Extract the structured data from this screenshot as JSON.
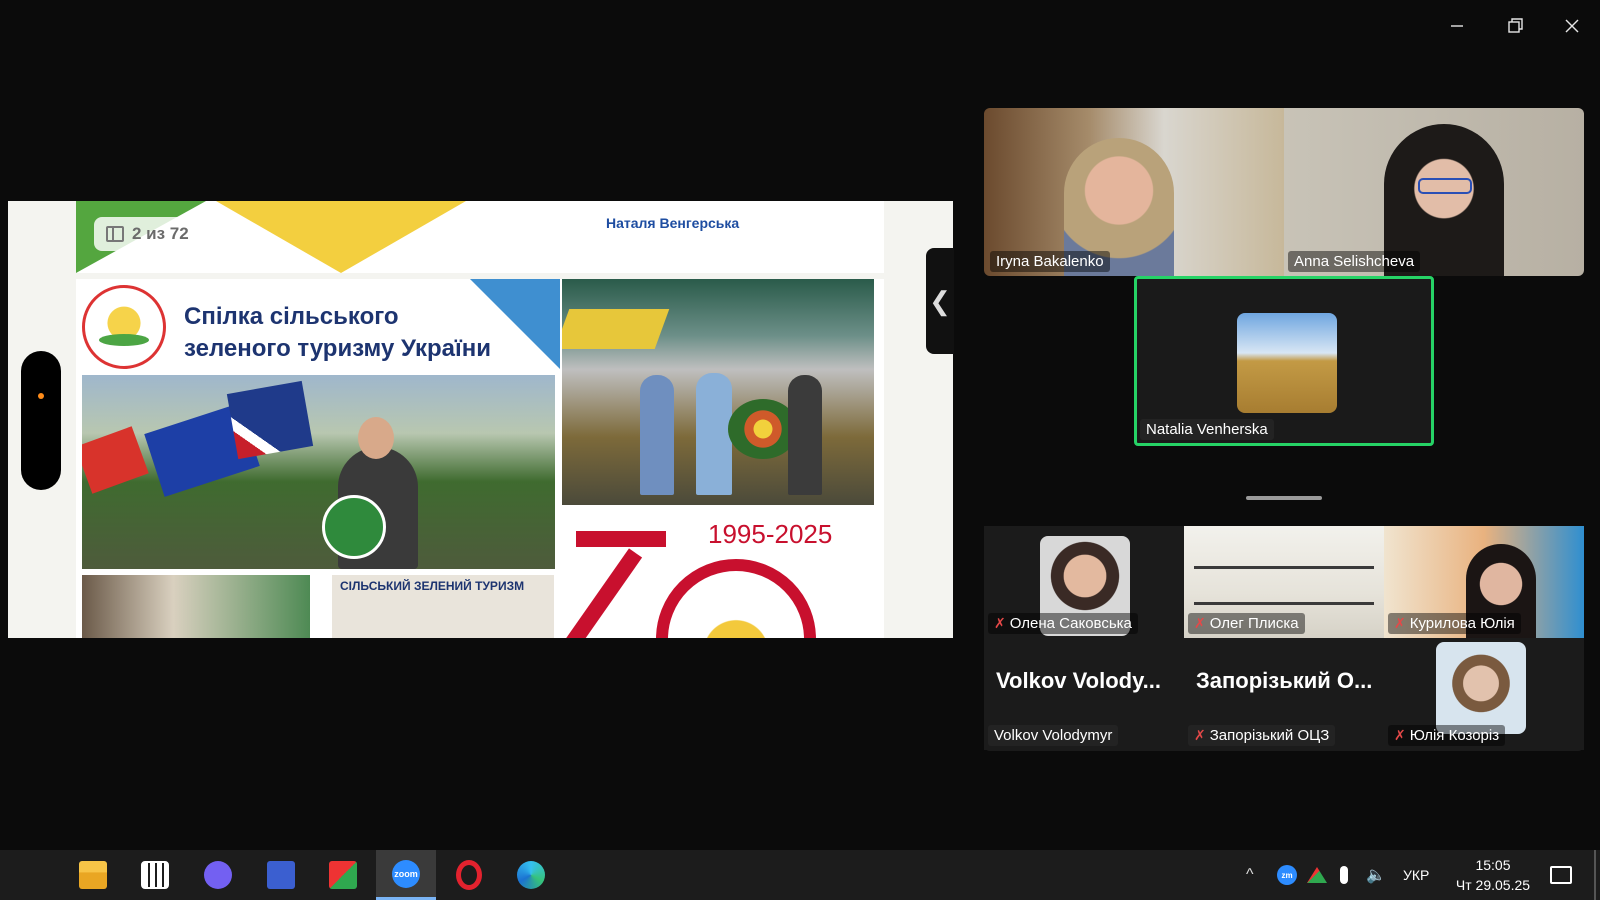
{
  "window": {
    "controls": [
      "minimize",
      "restore",
      "close"
    ]
  },
  "slide": {
    "page_counter": "2 из 72",
    "presenter_name": "Наталя Венгерська",
    "org_title_line1": "Спілка сільського",
    "org_title_line2": "зеленого туризму України",
    "anniversary_years": "1995-2025",
    "bottom_banner": "СІЛЬСЬКИЙ ЗЕЛЕНИЙ ТУРИЗМ",
    "colors": {
      "green": "#54a63f",
      "yellow": "#f3cf3f",
      "blue": "#1d3470",
      "red": "#c8102e"
    }
  },
  "collapse_toggle": "❮",
  "speakers": [
    {
      "name": "Iryna Bakalenko"
    },
    {
      "name": "Anna Selishcheva"
    },
    {
      "name": "Natalia Venherska",
      "active_speaker": true
    }
  ],
  "gallery": [
    {
      "name": "Олена Саковська",
      "muted": true
    },
    {
      "name": "Олег Плиска",
      "muted": true
    },
    {
      "name": "Курилова Юлія",
      "muted": true
    },
    {
      "display": "Volkov Volody...",
      "name": "Volkov Volodymyr",
      "muted": false
    },
    {
      "display": "Запорізький О...",
      "name": "Запорізький ОЦЗ",
      "muted": true
    },
    {
      "name": "Юлія Козоріз",
      "muted": true
    }
  ],
  "taskbar": {
    "apps": [
      "start-icon",
      "file-explorer-icon",
      "calculator-icon",
      "viber-icon",
      "save-icon",
      "pdf-icon",
      "zoom-icon",
      "opera-icon",
      "edge-icon"
    ],
    "zoom_label": "zoom",
    "tray_zoom_label": "zm",
    "active_app": "zoom-icon",
    "language": "УКР",
    "time": "15:05",
    "date": "Чт 29.05.25"
  }
}
